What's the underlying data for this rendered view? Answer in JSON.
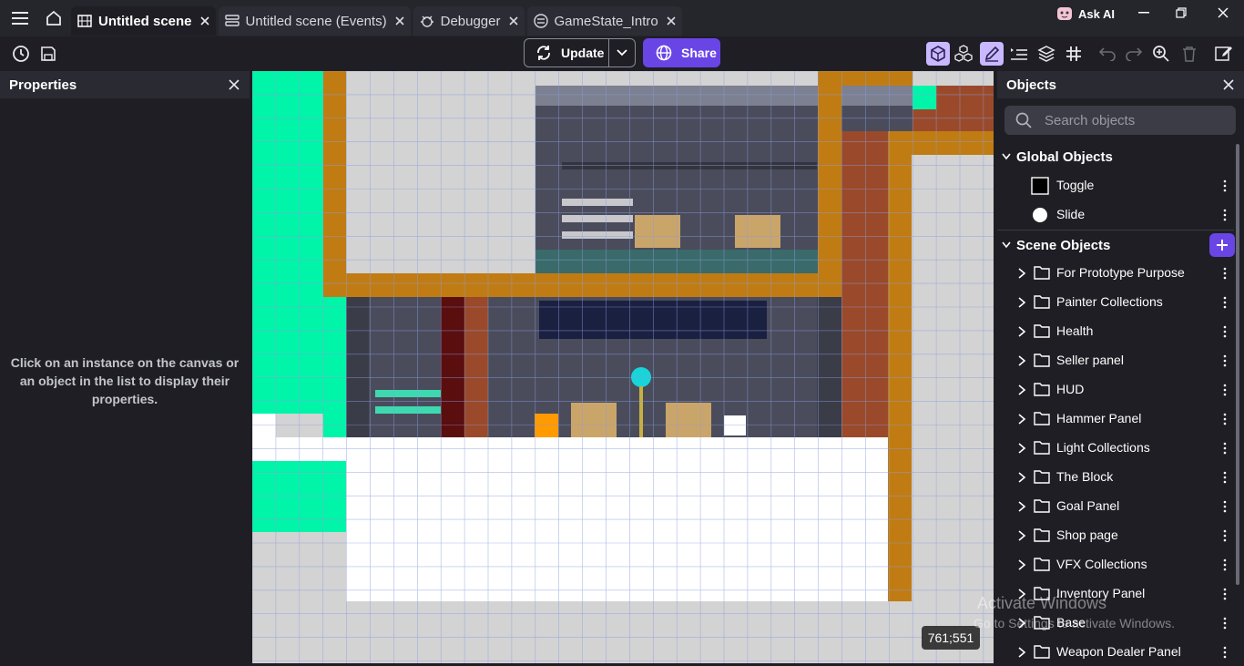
{
  "tabs": [
    {
      "label": "Untitled scene",
      "icon": "scene-icon",
      "active": true
    },
    {
      "label": "Untitled scene (Events)",
      "icon": "events-icon",
      "active": false
    },
    {
      "label": "Debugger",
      "icon": "debugger-icon",
      "active": false
    },
    {
      "label": "GameState_Intro",
      "icon": "external-events-icon",
      "active": false
    }
  ],
  "ask_ai": "Ask AI",
  "toolbar": {
    "update_label": "Update",
    "share_label": "Share"
  },
  "properties": {
    "title": "Properties",
    "message": "Click on an instance on the canvas or an object in the list to display their properties."
  },
  "canvas": {
    "coordinates": "761;551"
  },
  "objects": {
    "title": "Objects",
    "search_placeholder": "Search objects",
    "global_title": "Global Objects",
    "global_items": [
      {
        "label": "Toggle",
        "icon": "square-icon"
      },
      {
        "label": "Slide",
        "icon": "circle-icon"
      }
    ],
    "scene_title": "Scene Objects",
    "scene_items": [
      "For Prototype Purpose",
      "Painter Collections",
      "Health",
      "Seller panel",
      "HUD",
      "Hammer Panel",
      "Light Collections",
      "The Block",
      "Goal Panel",
      "Shop page",
      "VFX Collections",
      "Inventory Panel",
      "Base",
      "Weapon Dealer Panel"
    ]
  },
  "watermark": {
    "line1": "Activate Windows",
    "line2": "Go to Settings to activate Windows."
  },
  "colors": {
    "accent": "#6a45e6",
    "panel": "#1e1e24",
    "header": "#2a2a32"
  }
}
